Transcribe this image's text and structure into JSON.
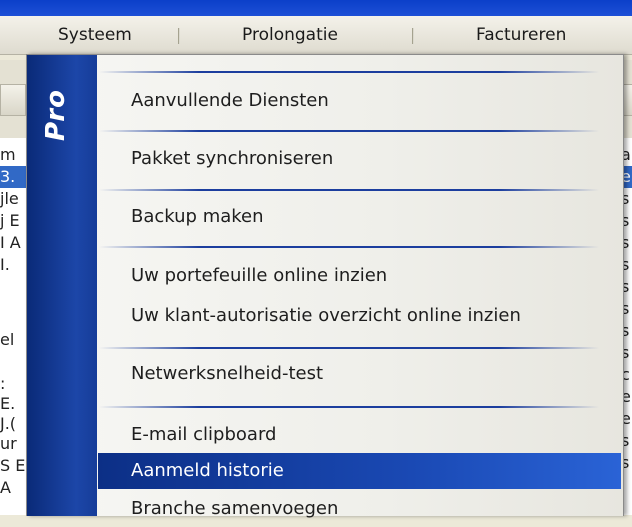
{
  "menubar": {
    "items": [
      {
        "label": "Systeem"
      },
      {
        "label": "Prolongatie"
      },
      {
        "label": "Factureren"
      }
    ]
  },
  "background": {
    "left_fragments": [
      "m",
      "3.",
      "jle",
      "j E",
      "I A",
      "I.",
      "",
      "el",
      "",
      ":",
      "E.",
      "J.(",
      "ur",
      "S E",
      "A"
    ],
    "right_fragments": [
      "a",
      "e",
      "s",
      "s",
      "s",
      "s",
      "s",
      "s",
      "s",
      "s",
      "c",
      "e",
      "e",
      "s",
      "s"
    ]
  },
  "dropdown": {
    "brand": "Pro",
    "items": [
      {
        "label": "Aanvullende Diensten"
      },
      {
        "label": "Pakket synchroniseren"
      },
      {
        "label": "Backup maken"
      },
      {
        "label": "Uw portefeuille online inzien"
      },
      {
        "label": "Uw klant-autorisatie overzicht online inzien"
      },
      {
        "label": "Netwerksnelheid-test"
      },
      {
        "label": "E-mail clipboard"
      },
      {
        "label": "Aanmeld historie",
        "selected": true
      },
      {
        "label": "Branche samenvoegen"
      }
    ]
  }
}
